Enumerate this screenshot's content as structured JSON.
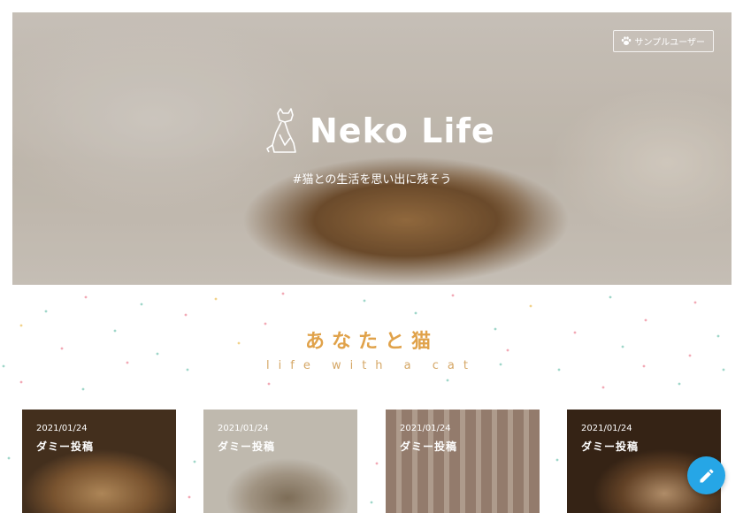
{
  "hero": {
    "brand_name": "Neko Life",
    "tagline": "#猫との生活を思い出に残そう",
    "user_button_label": "サンプルユーザー",
    "user_button_icon": "paw-icon",
    "logo_icon": "cat-logo-icon"
  },
  "section": {
    "title": "あなたと猫",
    "subtitle": "life with a cat",
    "title_color": "#e0a24a"
  },
  "posts": [
    {
      "date": "2021/01/24",
      "title": "ダミー投稿"
    },
    {
      "date": "2021/01/24",
      "title": "ダミー投稿"
    },
    {
      "date": "2021/01/24",
      "title": "ダミー投稿"
    },
    {
      "date": "2021/01/24",
      "title": "ダミー投稿"
    }
  ],
  "fab": {
    "icon": "pencil-icon",
    "color": "#26a6e6"
  }
}
